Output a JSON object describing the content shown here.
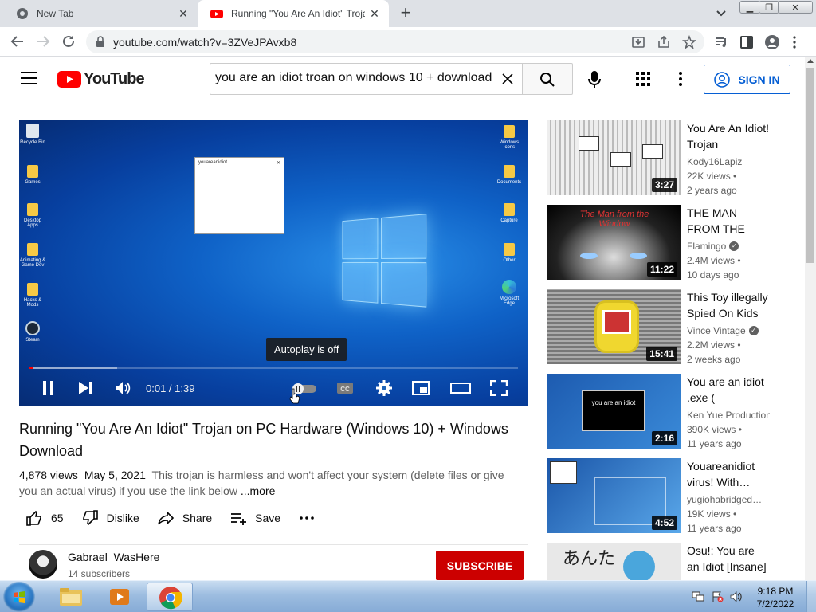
{
  "browser": {
    "tabs": [
      {
        "title": "New Tab"
      },
      {
        "title": "Running \"You Are An Idiot\" Trojan on PC Hardware (Windows 10) + Windows Download - YouTube"
      }
    ],
    "url": "youtube.com/watch?v=3ZVeJPAvxb8"
  },
  "header": {
    "logo_text": "YouTube",
    "search_value": "you are an idiot troan on windows 10 + download",
    "sign_in": "SIGN IN"
  },
  "player": {
    "time": "0:01 / 1:39",
    "progress_fraction": 0.01,
    "buffered_fraction": 0.18,
    "tooltip": "Autoplay is off",
    "popup_title": "youareanidiot",
    "desktop_icons": [
      "Recycle Bin",
      "Games",
      "Desktop Apps",
      "Animating & Game Dev",
      "Hacks & Mods",
      "Steam",
      "Windows Icons",
      "Documents",
      "Capture",
      "Other",
      "Microsoft Edge"
    ]
  },
  "video": {
    "title": "Running \"You Are An Idiot\" Trojan on PC Hardware (Windows 10) + Windows Download",
    "views": "4,878 views",
    "date": "May 5, 2021",
    "description": "This trojan is harmless and won't affect your system (delete files or give you an actual virus) if you use the link below",
    "more": "...more",
    "likes": "65",
    "dislike": "Dislike",
    "share": "Share",
    "save": "Save"
  },
  "channel": {
    "name": "Gabrael_WasHere",
    "subscribers": "14 subscribers",
    "subscribe": "SUBSCRIBE"
  },
  "recommendations": [
    {
      "title": "You Are An Idiot! Trojan",
      "channel": "Kody16Lapiz",
      "verified": false,
      "views": "22K views •",
      "age": "2 years ago",
      "duration": "3:27"
    },
    {
      "title": "THE MAN FROM THE WINDOW",
      "channel": "Flamingo",
      "verified": true,
      "views": "2.4M views •",
      "age": "10 days ago",
      "duration": "11:22"
    },
    {
      "title": "This Toy illegally Spied On Kids",
      "channel": "Vince Vintage",
      "verified": true,
      "views": "2.2M views •",
      "age": "2 weeks ago",
      "duration": "15:41"
    },
    {
      "title": "You are an idiot .exe (",
      "channel": "Ken Yue Productions",
      "verified": false,
      "views": "390K views •",
      "age": "11 years ago",
      "duration": "2:16"
    },
    {
      "title": "Youareanidiot virus! With…",
      "channel": "yugiohabridged…",
      "verified": false,
      "views": "19K views •",
      "age": "11 years ago",
      "duration": "4:52"
    },
    {
      "title": "Osu!: You are an Idiot [Insane]",
      "channel": "",
      "verified": false,
      "views": "",
      "age": "",
      "duration": ""
    }
  ],
  "thumb_texts": {
    "man_window": "The Man from the Window",
    "idiot_exe": "you are an idiot",
    "osu": "あんた"
  },
  "taskbar": {
    "time": "9:18 PM",
    "date": "7/2/2022"
  },
  "colors": {
    "youtube_red": "#ff0000",
    "subscribe_red": "#cc0000",
    "link_blue": "#065fd4"
  }
}
